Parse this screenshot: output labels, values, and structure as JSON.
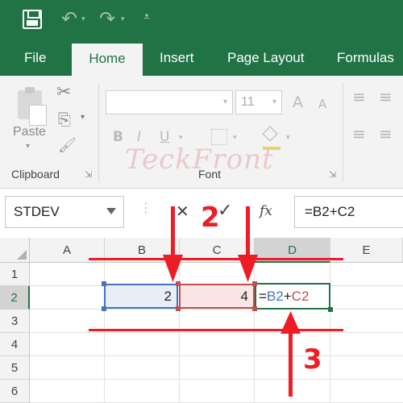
{
  "quick_access": {
    "save_icon": "save-icon",
    "undo_icon": "undo-icon",
    "redo_icon": "redo-icon",
    "undo_glyph": "↶",
    "redo_glyph": "↷",
    "dropdown_glyph": "▾",
    "customize_glyph": "⩡"
  },
  "tabs": [
    {
      "label": "File",
      "active": false
    },
    {
      "label": "Home",
      "active": true
    },
    {
      "label": "Insert",
      "active": false
    },
    {
      "label": "Page Layout",
      "active": false
    },
    {
      "label": "Formulas",
      "active": false
    }
  ],
  "ribbon": {
    "clipboard": {
      "group_label": "Clipboard",
      "paste_label": "Paste",
      "cut_glyph": "✂",
      "copy_glyph": "⎘",
      "painter_glyph": "🖌",
      "launcher_glyph": "⇲"
    },
    "font": {
      "group_label": "Font",
      "font_name": "",
      "font_size": "11",
      "grow_glyph": "A",
      "shrink_glyph": "A",
      "bold": "B",
      "italic": "I",
      "underline": "U",
      "launcher_glyph": "⇲"
    },
    "alignment_glyphs": [
      "≡",
      "≡"
    ]
  },
  "watermark": "TeckFront",
  "formula_bar": {
    "name_box": "STDEV",
    "cancel_glyph": "✕",
    "enter_glyph": "✓",
    "fx_label": "fx",
    "formula": "=B2+C2"
  },
  "grid": {
    "columns": [
      "A",
      "B",
      "C",
      "D",
      "E"
    ],
    "rows": [
      "1",
      "2",
      "3",
      "4",
      "5",
      "6"
    ],
    "selected_column": "D",
    "selected_row": "2",
    "cells": {
      "B2": "2",
      "C2": "4",
      "D2": {
        "eq": "=",
        "ref1": "B2",
        "op": "+",
        "ref2": "C2"
      }
    }
  },
  "annotations": {
    "label_2": "2",
    "label_3": "3",
    "color": "#ee1c25"
  },
  "colors": {
    "accent": "#217346",
    "ref_blue": "#4472c4",
    "ref_red": "#c0504d"
  }
}
